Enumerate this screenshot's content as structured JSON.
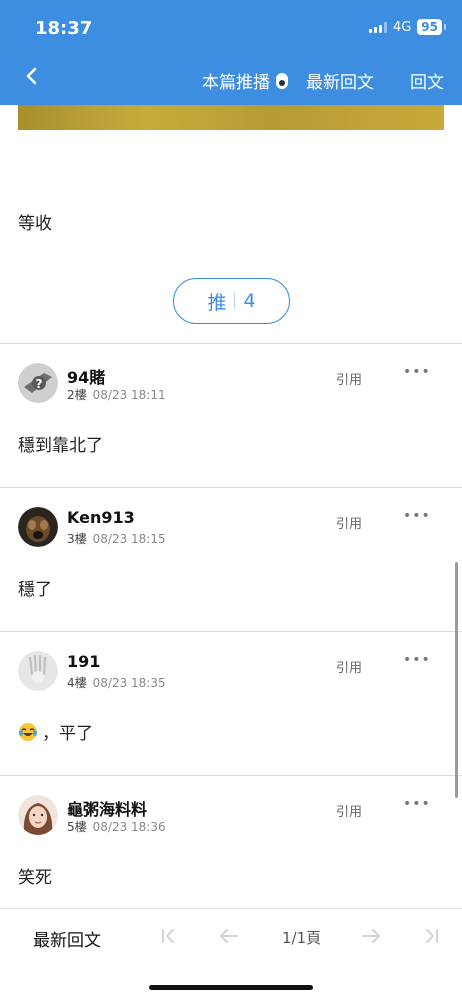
{
  "status": {
    "time": "18:37",
    "network": "4G",
    "battery": "95"
  },
  "nav": {
    "push_label": "本篇推播",
    "latest_label": "最新回文",
    "reply_label": "回文"
  },
  "post": {
    "text": "等收"
  },
  "push": {
    "label": "推",
    "count": "4"
  },
  "comments": [
    {
      "name": "94賭",
      "floor": "2樓",
      "time": "08/23 18:11",
      "quote": "引用",
      "body": "穩到靠北了"
    },
    {
      "name": "Ken913",
      "floor": "3樓",
      "time": "08/23 18:15",
      "quote": "引用",
      "body": "穩了"
    },
    {
      "name": "191",
      "floor": "4樓",
      "time": "08/23 18:35",
      "quote": "引用",
      "body": "，平了"
    },
    {
      "name": "龜粥海料料",
      "floor": "5樓",
      "time": "08/23 18:36",
      "quote": "引用",
      "body": "笑死"
    }
  ],
  "footer": {
    "latest_label": "最新回文",
    "page": "1/1頁"
  },
  "colors": {
    "header": "#3d8ee0",
    "accent": "#3d8ee0"
  }
}
